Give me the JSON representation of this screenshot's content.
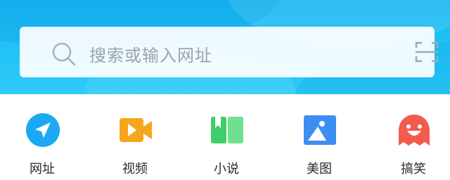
{
  "search": {
    "placeholder": "搜索或输入网址"
  },
  "shortcuts": [
    {
      "label": "网址",
      "icon": "navigation-arrow-icon",
      "color": "#1aa9f2"
    },
    {
      "label": "视频",
      "icon": "video-camera-icon",
      "color": "#f7a51d"
    },
    {
      "label": "小说",
      "icon": "open-book-icon",
      "color": "#3ecf68"
    },
    {
      "label": "美图",
      "icon": "picture-mountain-icon",
      "color": "#3d8ef0"
    },
    {
      "label": "搞笑",
      "icon": "ghost-face-icon",
      "color": "#f25b4e"
    }
  ],
  "colors": {
    "banner": "#1fbff5",
    "search_background": "#f1f8fc",
    "placeholder_text": "#9aa4ad"
  }
}
